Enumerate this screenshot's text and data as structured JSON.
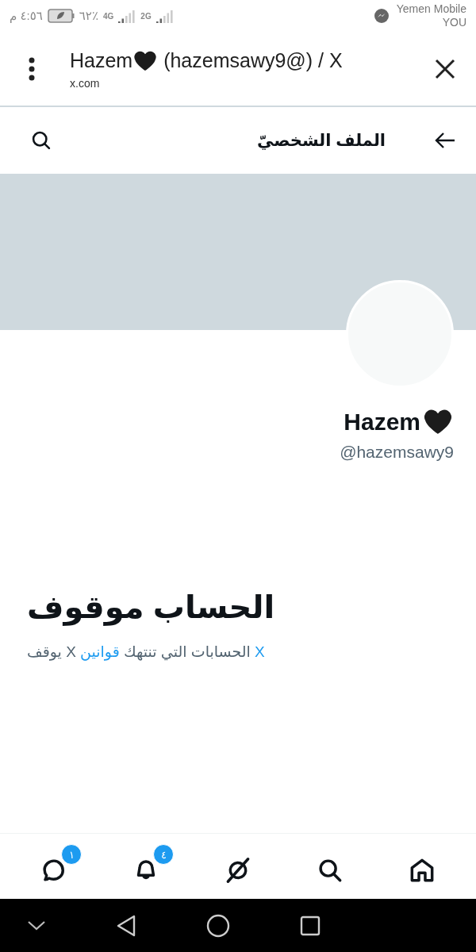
{
  "status_bar": {
    "time": "٤:٥٦ م",
    "battery": "٦٢٪",
    "network_1": "4G",
    "network_2": "2G",
    "carrier": "Yemen Mobile",
    "carrier_2": "YOU"
  },
  "browser_header": {
    "title_name": "Hazem",
    "title_rest": " (hazemsawy9@) / X",
    "url": "x.com"
  },
  "profile_bar": {
    "title": "الملف الشخصيّ"
  },
  "profile": {
    "name": "Hazem",
    "handle": "@hazemsawy9"
  },
  "notice": {
    "heading": "الحساب موقوف",
    "parts": [
      {
        "text": "X",
        "link": true
      },
      {
        "text": " الحسابات التي تنتهك ",
        "link": false
      },
      {
        "text": "قوانين",
        "link": true
      },
      {
        "text": " X يوقف",
        "link": false
      }
    ]
  },
  "bottom_nav": [
    {
      "kind": "home"
    },
    {
      "kind": "search"
    },
    {
      "kind": "grok"
    },
    {
      "kind": "notifications",
      "badge": "٤"
    },
    {
      "kind": "messages",
      "badge": "١"
    }
  ]
}
